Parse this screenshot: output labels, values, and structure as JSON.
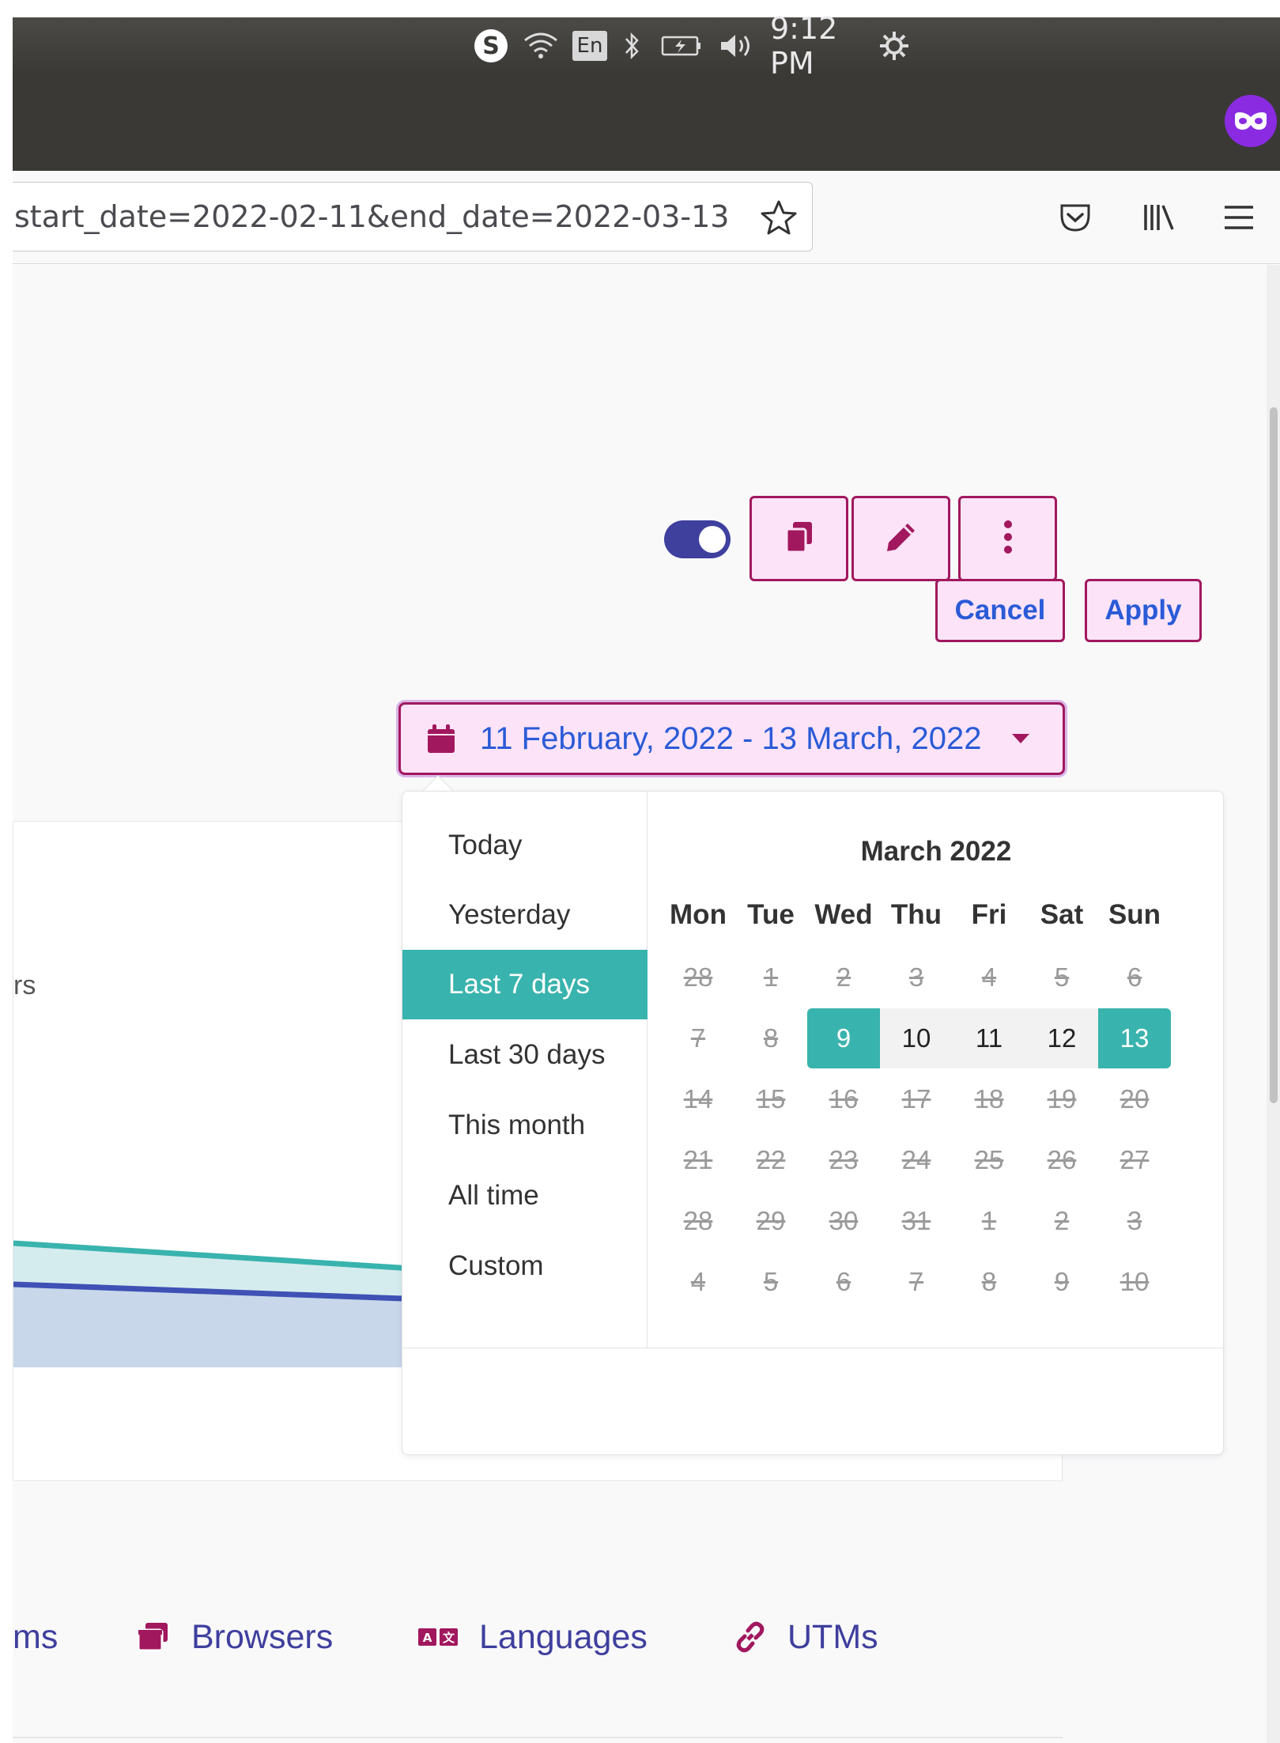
{
  "system_tray": {
    "keyboard_layout": "En",
    "clock": "9:12 PM",
    "icons": [
      "skype-icon",
      "wifi-icon",
      "keyboard-layout-icon",
      "bluetooth-icon",
      "battery-charging-icon",
      "volume-icon",
      "power-settings-icon"
    ]
  },
  "browser": {
    "url": "start_date=2022-02-11&end_date=2022-03-13",
    "private_icon": "private-browsing-mask-icon",
    "toolbar_icons": [
      "bookmark-star-icon",
      "pocket-icon",
      "library-icon",
      "hamburger-menu-icon"
    ]
  },
  "toolbar": {
    "toggle_state": "on",
    "buttons": [
      "copy-icon",
      "edit-pencil-icon",
      "more-vertical-icon"
    ]
  },
  "date_range": {
    "label": "11 February, 2022 - 13 March, 2022"
  },
  "chart": {
    "legend_fragment": "rs"
  },
  "picker": {
    "ranges": [
      "Today",
      "Yesterday",
      "Last 7 days",
      "Last 30 days",
      "This month",
      "All time",
      "Custom"
    ],
    "active_range": "Last 7 days",
    "month_title": "March 2022",
    "weekdays": [
      "Mon",
      "Tue",
      "Wed",
      "Thu",
      "Fri",
      "Sat",
      "Sun"
    ],
    "weeks": [
      [
        "28",
        "1",
        "2",
        "3",
        "4",
        "5",
        "6"
      ],
      [
        "7",
        "8",
        "9",
        "10",
        "11",
        "12",
        "13"
      ],
      [
        "14",
        "15",
        "16",
        "17",
        "18",
        "19",
        "20"
      ],
      [
        "21",
        "22",
        "23",
        "24",
        "25",
        "26",
        "27"
      ],
      [
        "28",
        "29",
        "30",
        "31",
        "1",
        "2",
        "3"
      ],
      [
        "4",
        "5",
        "6",
        "7",
        "8",
        "9",
        "10"
      ]
    ],
    "selected_start": "9",
    "selected_end": "13",
    "enabled_days": [
      "9",
      "10",
      "11",
      "12",
      "13"
    ],
    "cancel_label": "Cancel",
    "apply_label": "Apply"
  },
  "tabs": [
    {
      "label": "ms",
      "icon": ""
    },
    {
      "label": "Browsers",
      "icon": "browsers-icon"
    },
    {
      "label": "Languages",
      "icon": "languages-icon"
    },
    {
      "label": "UTMs",
      "icon": "link-icon"
    }
  ],
  "colors": {
    "accent": "#39b3ad",
    "brand_border": "#a1185e",
    "button_bg": "#fde3f8",
    "link_text": "#2a5bd7",
    "toggle": "#3f3f9e",
    "series_visitors": "#39b3ad",
    "series_pageviews": "#3f51b5"
  }
}
